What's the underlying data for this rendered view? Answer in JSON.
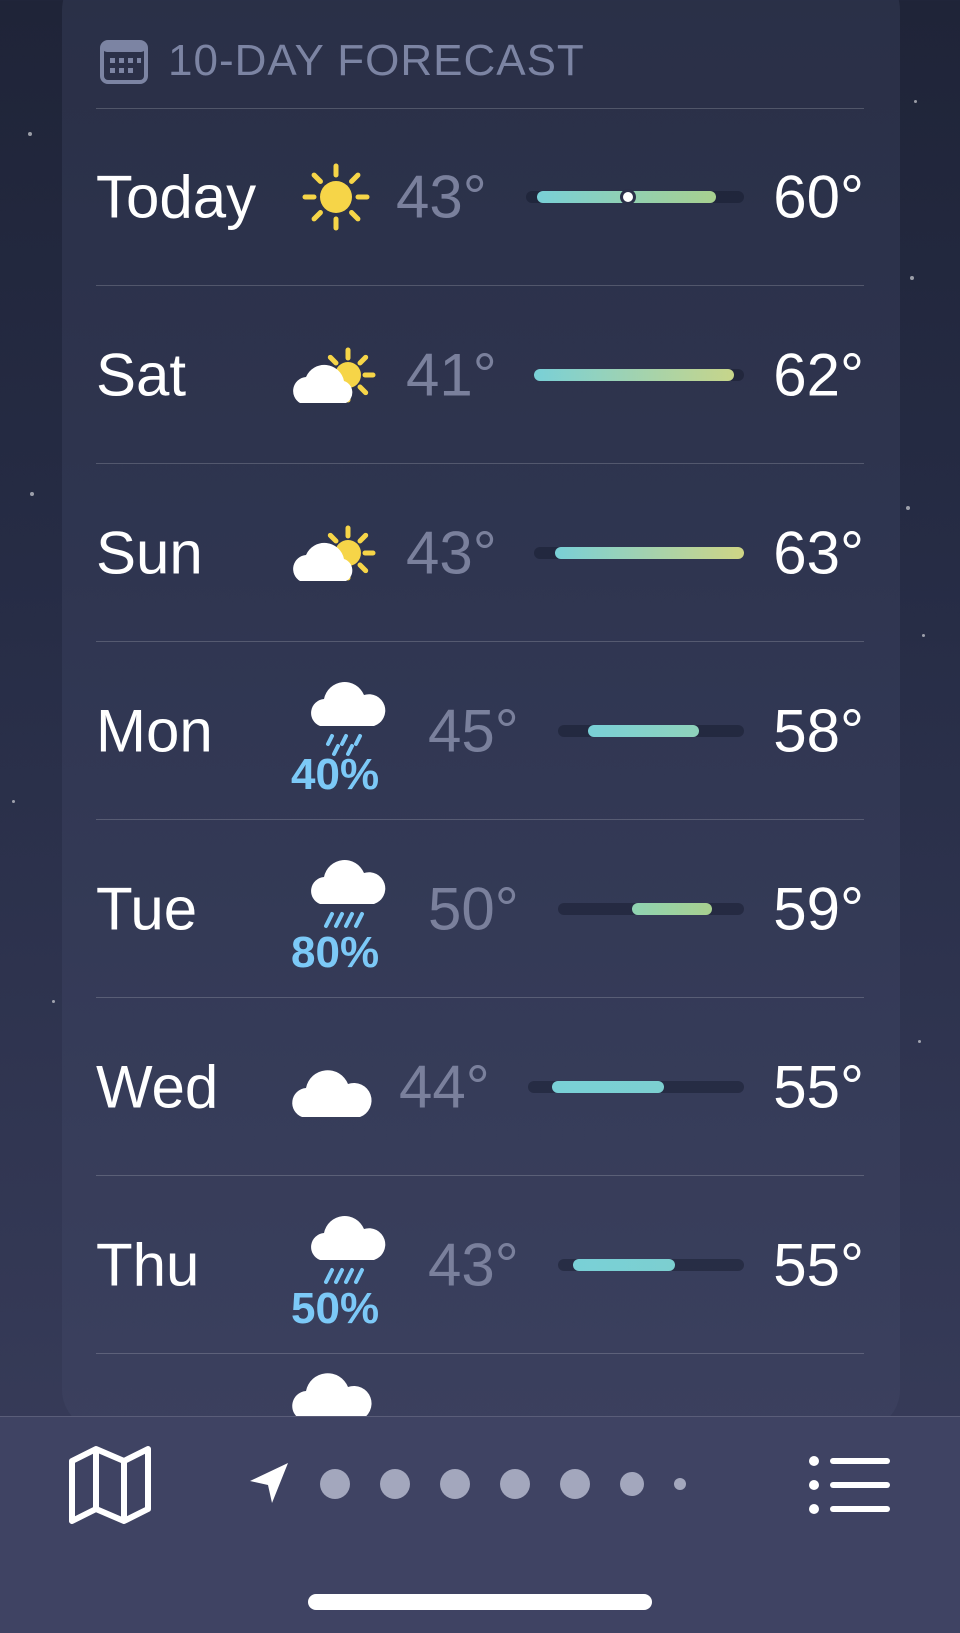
{
  "forecast": {
    "title": "10-DAY FORECAST",
    "header_icon": "calendar-icon",
    "days": [
      {
        "day": "Today",
        "icon": "sun-icon",
        "precip": "",
        "low": "43°",
        "high": "60°",
        "bar_start": 0.05,
        "bar_end": 0.87,
        "current": 0.47,
        "color_from": "#79d0d7",
        "color_to": "#a8d08f"
      },
      {
        "day": "Sat",
        "icon": "partly-cloudy-icon",
        "precip": "",
        "low": "41°",
        "high": "62°",
        "bar_start": 0.0,
        "bar_end": 0.95,
        "color_from": "#79d0d7",
        "color_to": "#c7d58a"
      },
      {
        "day": "Sun",
        "icon": "partly-cloudy-icon",
        "precip": "",
        "low": "43°",
        "high": "63°",
        "bar_start": 0.1,
        "bar_end": 1.0,
        "color_from": "#79d0d7",
        "color_to": "#cfd585"
      },
      {
        "day": "Mon",
        "icon": "rain-icon",
        "precip": "40%",
        "low": "45°",
        "high": "58°",
        "bar_start": 0.16,
        "bar_end": 0.76,
        "color_from": "#79d0d7",
        "color_to": "#8fd2bb"
      },
      {
        "day": "Tue",
        "icon": "heavy-rain-icon",
        "precip": "80%",
        "low": "50°",
        "high": "59°",
        "bar_start": 0.4,
        "bar_end": 0.83,
        "color_from": "#8fd3b2",
        "color_to": "#a8d08f"
      },
      {
        "day": "Wed",
        "icon": "cloud-icon",
        "precip": "",
        "low": "44°",
        "high": "55°",
        "bar_start": 0.11,
        "bar_end": 0.63,
        "color_from": "#79d0d7",
        "color_to": "#7ccfd0"
      },
      {
        "day": "Thu",
        "icon": "heavy-rain-icon",
        "precip": "50%",
        "low": "43°",
        "high": "55°",
        "bar_start": 0.08,
        "bar_end": 0.63,
        "color_from": "#79d0d7",
        "color_to": "#7ccfd0"
      },
      {
        "day": "",
        "icon": "cloud-icon",
        "precip": "",
        "low": "",
        "high": ""
      }
    ]
  },
  "toolbar": {
    "map_icon": "map-icon",
    "location_icon": "location-arrow-icon",
    "page_dots": 7,
    "list_icon": "list-icon"
  },
  "colors": {
    "precip_blue": "#7cc9f7",
    "low_temp_gray": "#7a809c",
    "sun_yellow": "#f6d548"
  }
}
